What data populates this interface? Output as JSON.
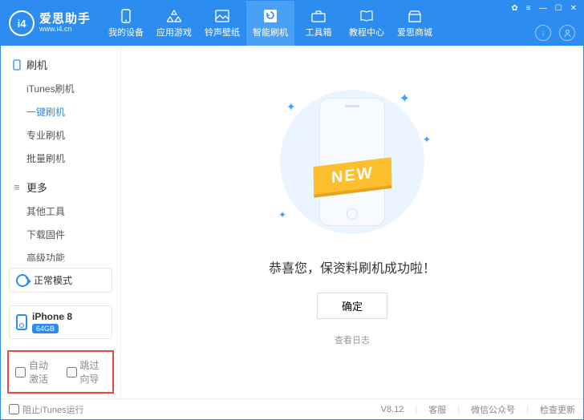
{
  "logo": {
    "badge": "i4",
    "title": "爱思助手",
    "sub": "www.i4.cn"
  },
  "topnav": [
    {
      "label": "我的设备"
    },
    {
      "label": "应用游戏"
    },
    {
      "label": "铃声壁纸"
    },
    {
      "label": "智能刷机"
    },
    {
      "label": "工具箱"
    },
    {
      "label": "教程中心"
    },
    {
      "label": "爱思商城"
    }
  ],
  "sidebar": {
    "sec1": {
      "head": "刷机",
      "items": [
        "iTunes刷机",
        "一键刷机",
        "专业刷机",
        "批量刷机"
      ]
    },
    "sec2": {
      "head": "更多",
      "items": [
        "其他工具",
        "下载固件",
        "高级功能"
      ]
    }
  },
  "mode": {
    "label": "正常模式"
  },
  "device": {
    "name": "iPhone 8",
    "cap": "64GB"
  },
  "opts": {
    "a": "自动激活",
    "b": "跳过向导"
  },
  "main": {
    "ribbon": "NEW",
    "success": "恭喜您，保资料刷机成功啦！",
    "ok": "确定",
    "log": "查看日志"
  },
  "status": {
    "block": "阻止iTunes运行",
    "ver": "V8.12",
    "svc": "客服",
    "wx": "微信公众号",
    "upd": "检查更新"
  }
}
